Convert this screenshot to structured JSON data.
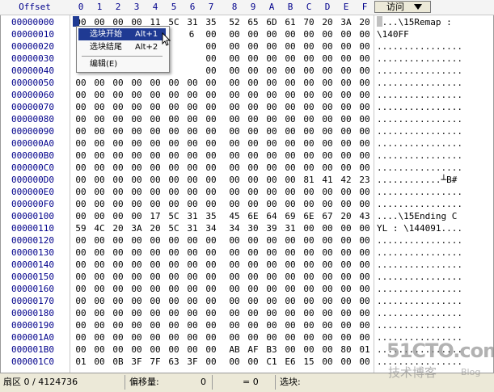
{
  "header": {
    "offset_label": "Offset",
    "columns": [
      "0",
      "1",
      "2",
      "3",
      "4",
      "5",
      "6",
      "7",
      "8",
      "9",
      "A",
      "B",
      "C",
      "D",
      "E",
      "F"
    ],
    "visit_label": "访问"
  },
  "offsets": [
    "00000000",
    "00000010",
    "00000020",
    "00000030",
    "00000040",
    "00000050",
    "00000060",
    "00000070",
    "00000080",
    "00000090",
    "000000A0",
    "000000B0",
    "000000C0",
    "000000D0",
    "000000E0",
    "000000F0",
    "00000100",
    "00000110",
    "00000120",
    "00000130",
    "00000140",
    "00000150",
    "00000160",
    "00000170",
    "00000180",
    "00000190",
    "000001A0",
    "000001B0",
    "000001C0"
  ],
  "hex_rows": [
    [
      "00",
      "00",
      "00",
      "00",
      "11",
      "5C",
      "31",
      "35",
      "52",
      "65",
      "6D",
      "61",
      "70",
      "20",
      "3A",
      "20"
    ],
    [
      "",
      "",
      "",
      "",
      "",
      "",
      "",
      "00",
      "00",
      "00",
      "00",
      "00",
      "00",
      "00",
      "00",
      "00"
    ],
    [
      "",
      "",
      "",
      "",
      "",
      "",
      "",
      "00",
      "00",
      "00",
      "00",
      "00",
      "00",
      "00",
      "00",
      "00"
    ],
    [
      "",
      "",
      "",
      "",
      "",
      "",
      "",
      "00",
      "00",
      "00",
      "00",
      "00",
      "00",
      "00",
      "00",
      "00"
    ],
    [
      "",
      "",
      "",
      "",
      "",
      "",
      "",
      "00",
      "00",
      "00",
      "00",
      "00",
      "00",
      "00",
      "00",
      "00"
    ],
    [
      "00",
      "00",
      "00",
      "00",
      "00",
      "00",
      "00",
      "00",
      "00",
      "00",
      "00",
      "00",
      "00",
      "00",
      "00",
      "00"
    ],
    [
      "00",
      "00",
      "00",
      "00",
      "00",
      "00",
      "00",
      "00",
      "00",
      "00",
      "00",
      "00",
      "00",
      "00",
      "00",
      "00"
    ],
    [
      "00",
      "00",
      "00",
      "00",
      "00",
      "00",
      "00",
      "00",
      "00",
      "00",
      "00",
      "00",
      "00",
      "00",
      "00",
      "00"
    ],
    [
      "00",
      "00",
      "00",
      "00",
      "00",
      "00",
      "00",
      "00",
      "00",
      "00",
      "00",
      "00",
      "00",
      "00",
      "00",
      "00"
    ],
    [
      "00",
      "00",
      "00",
      "00",
      "00",
      "00",
      "00",
      "00",
      "00",
      "00",
      "00",
      "00",
      "00",
      "00",
      "00",
      "00"
    ],
    [
      "00",
      "00",
      "00",
      "00",
      "00",
      "00",
      "00",
      "00",
      "00",
      "00",
      "00",
      "00",
      "00",
      "00",
      "00",
      "00"
    ],
    [
      "00",
      "00",
      "00",
      "00",
      "00",
      "00",
      "00",
      "00",
      "00",
      "00",
      "00",
      "00",
      "00",
      "00",
      "00",
      "00"
    ],
    [
      "00",
      "00",
      "00",
      "00",
      "00",
      "00",
      "00",
      "00",
      "00",
      "00",
      "00",
      "00",
      "00",
      "00",
      "00",
      "00"
    ],
    [
      "00",
      "00",
      "00",
      "00",
      "00",
      "00",
      "00",
      "00",
      "00",
      "00",
      "00",
      "00",
      "81",
      "41",
      "42",
      "23"
    ],
    [
      "00",
      "00",
      "00",
      "00",
      "00",
      "00",
      "00",
      "00",
      "00",
      "00",
      "00",
      "00",
      "00",
      "00",
      "00",
      "00"
    ],
    [
      "00",
      "00",
      "00",
      "00",
      "00",
      "00",
      "00",
      "00",
      "00",
      "00",
      "00",
      "00",
      "00",
      "00",
      "00",
      "00"
    ],
    [
      "00",
      "00",
      "00",
      "00",
      "17",
      "5C",
      "31",
      "35",
      "45",
      "6E",
      "64",
      "69",
      "6E",
      "67",
      "20",
      "43"
    ],
    [
      "59",
      "4C",
      "20",
      "3A",
      "20",
      "5C",
      "31",
      "34",
      "34",
      "30",
      "39",
      "31",
      "00",
      "00",
      "00",
      "00"
    ],
    [
      "00",
      "00",
      "00",
      "00",
      "00",
      "00",
      "00",
      "00",
      "00",
      "00",
      "00",
      "00",
      "00",
      "00",
      "00",
      "00"
    ],
    [
      "00",
      "00",
      "00",
      "00",
      "00",
      "00",
      "00",
      "00",
      "00",
      "00",
      "00",
      "00",
      "00",
      "00",
      "00",
      "00"
    ],
    [
      "00",
      "00",
      "00",
      "00",
      "00",
      "00",
      "00",
      "00",
      "00",
      "00",
      "00",
      "00",
      "00",
      "00",
      "00",
      "00"
    ],
    [
      "00",
      "00",
      "00",
      "00",
      "00",
      "00",
      "00",
      "00",
      "00",
      "00",
      "00",
      "00",
      "00",
      "00",
      "00",
      "00"
    ],
    [
      "00",
      "00",
      "00",
      "00",
      "00",
      "00",
      "00",
      "00",
      "00",
      "00",
      "00",
      "00",
      "00",
      "00",
      "00",
      "00"
    ],
    [
      "00",
      "00",
      "00",
      "00",
      "00",
      "00",
      "00",
      "00",
      "00",
      "00",
      "00",
      "00",
      "00",
      "00",
      "00",
      "00"
    ],
    [
      "00",
      "00",
      "00",
      "00",
      "00",
      "00",
      "00",
      "00",
      "00",
      "00",
      "00",
      "00",
      "00",
      "00",
      "00",
      "00"
    ],
    [
      "00",
      "00",
      "00",
      "00",
      "00",
      "00",
      "00",
      "00",
      "00",
      "00",
      "00",
      "00",
      "00",
      "00",
      "00",
      "00"
    ],
    [
      "00",
      "00",
      "00",
      "00",
      "00",
      "00",
      "00",
      "00",
      "00",
      "00",
      "00",
      "00",
      "00",
      "00",
      "00",
      "00"
    ],
    [
      "00",
      "00",
      "00",
      "00",
      "00",
      "00",
      "00",
      "00",
      "AB",
      "AF",
      "B3",
      "00",
      "00",
      "00",
      "80",
      "01"
    ],
    [
      "01",
      "00",
      "0B",
      "3F",
      "7F",
      "63",
      "3F",
      "00",
      "00",
      "00",
      "C1",
      "E6",
      "15",
      "00",
      "00",
      "00"
    ]
  ],
  "partial_row1": {
    "col6": "6"
  },
  "ascii_rows": [
    "....\\15Remap :",
    "\\140FF",
    "................",
    "................",
    "................",
    "................",
    "................",
    "................",
    "................",
    "................",
    "................",
    "................",
    "................",
    "............┴B#",
    "................",
    "................",
    "....\\15Ending C",
    "YL : \\144091....",
    "................",
    "................",
    "................",
    "................",
    "................",
    "................",
    "................",
    "................",
    "................",
    "................",
    "................"
  ],
  "context_menu": {
    "items": [
      {
        "label": "选块开始",
        "shortcut": "Alt+1"
      },
      {
        "label": "选块结尾",
        "shortcut": "Alt+2"
      },
      {
        "label": "编辑(E)",
        "shortcut": ""
      }
    ]
  },
  "status": {
    "sector": "扇区 0 / 4124736",
    "offset_label": "偏移量:",
    "offset_value": "0",
    "eq_label": "= 0",
    "block_label": "选块:"
  },
  "watermark": {
    "line1": "51CTO.com",
    "line2": "技术博客",
    "line3": "Blog"
  },
  "colors": {
    "offset_text": "#00008b",
    "selection": "#1f3a93",
    "status_bg": "#ece9d8"
  }
}
